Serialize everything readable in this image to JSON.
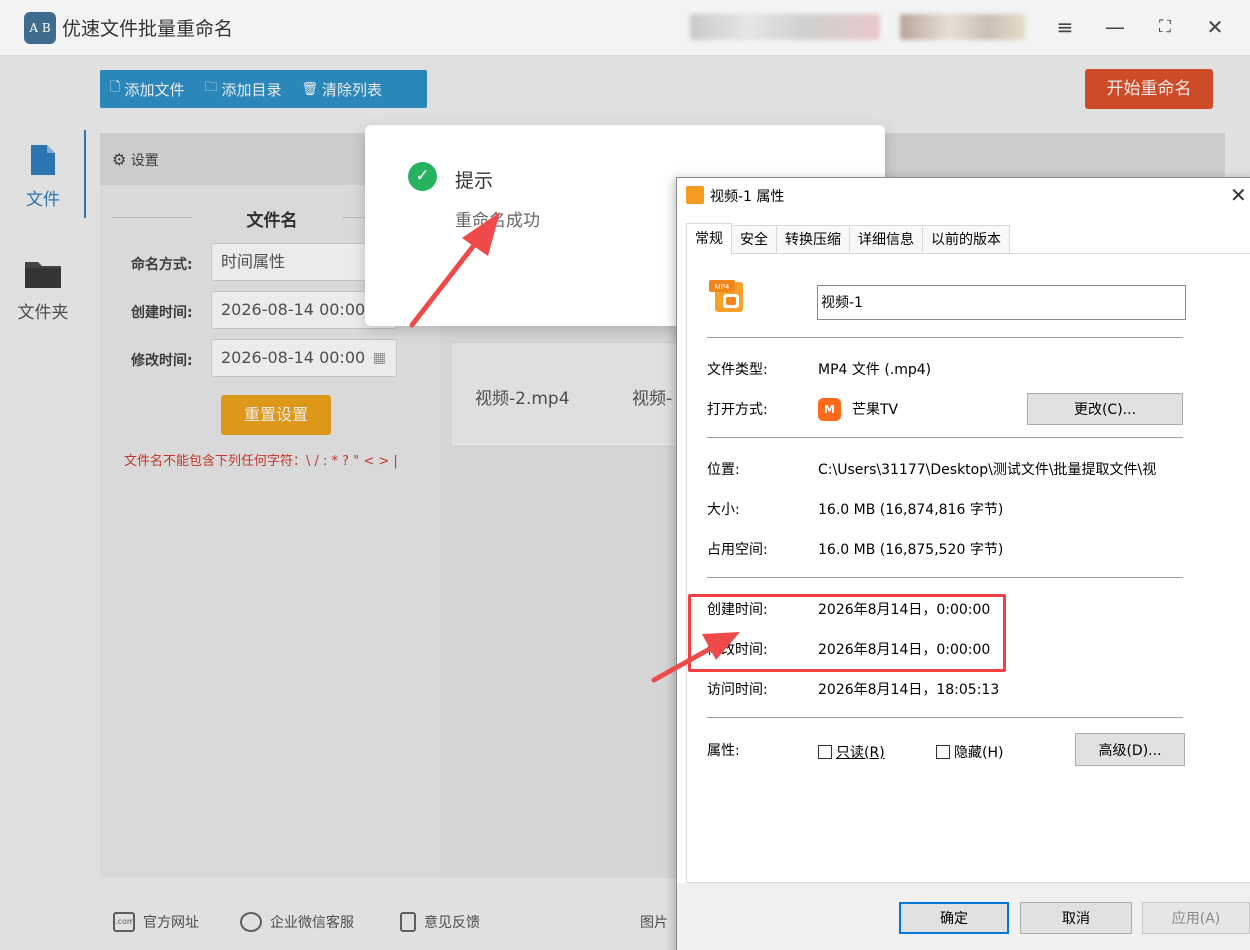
{
  "app": {
    "title": "优速文件批量重命名",
    "logo_text": "A B",
    "window_buttons": [
      "≡",
      "—",
      "⛶",
      "✕"
    ],
    "toolbar": {
      "add_file": "添加文件",
      "add_folder": "添加目录",
      "clear_list": "清除列表",
      "start": "开始重命名"
    },
    "sidebar": [
      {
        "label": "文件",
        "icon": "file-icon"
      },
      {
        "label": "文件夹",
        "icon": "folder-icon"
      }
    ],
    "settings": {
      "header": "设置",
      "section": "文件名",
      "naming_mode_label": "命名方式:",
      "naming_mode_value": "时间属性",
      "created_label": "创建时间:",
      "created_value": "2026-08-14 00:00",
      "modified_label": "修改时间:",
      "modified_value": "2026-08-14 00:00",
      "reset": "重置设置",
      "warning": "文件名不能包含下列任何字符：\\ / : * ? \" < > |"
    },
    "file_list": [
      "视频-2.mp4",
      "视频-"
    ],
    "footer": {
      "website": "官方网址",
      "wechat": "企业微信客服",
      "feedback": "意见反馈",
      "trailing": "图片"
    }
  },
  "toast": {
    "title": "提示",
    "message": "重命名成功"
  },
  "dialog": {
    "title": "视频-1 属性",
    "close": "✕",
    "tabs": [
      "常规",
      "安全",
      "转换压缩",
      "详细信息",
      "以前的版本"
    ],
    "file_name": "视频-1",
    "icon_text": "MP4",
    "rows": {
      "type_label": "文件类型:",
      "type_value": "MP4 文件 (.mp4)",
      "open_label": "打开方式:",
      "open_value": "芒果TV",
      "change_btn": "更改(C)...",
      "location_label": "位置:",
      "location_value": "C:\\Users\\31177\\Desktop\\测试文件\\批量提取文件\\视",
      "size_label": "大小:",
      "size_value": "16.0 MB (16,874,816 字节)",
      "disk_label": "占用空间:",
      "disk_value": "16.0 MB (16,875,520 字节)",
      "created_label": "创建时间:",
      "created_value": "2026年8月14日，0:00:00",
      "modified_label": "修改时间:",
      "modified_value": "2026年8月14日，0:00:00",
      "accessed_label": "访问时间:",
      "accessed_value": "2026年8月14日，18:05:13",
      "attr_label": "属性:",
      "readonly": "只读(R)",
      "hidden": "隐藏(H)",
      "advanced": "高级(D)..."
    },
    "buttons": {
      "ok": "确定",
      "cancel": "取消",
      "apply": "应用(A)"
    }
  },
  "colors": {
    "toolbar_blue": "#2f93c9",
    "start_red": "#e0522b",
    "reset_orange": "#f0a51c",
    "success_green": "#27b25f",
    "annotation_red": "#f04040"
  }
}
